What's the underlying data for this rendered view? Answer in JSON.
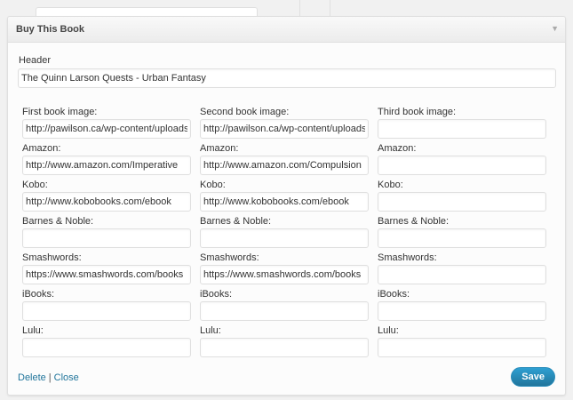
{
  "widget": {
    "title": "Buy This Book",
    "toggle_icon": "triangle-down-icon"
  },
  "header": {
    "label": "Header",
    "value": "The Quinn Larson Quests - Urban Fantasy"
  },
  "columns": [
    {
      "fields": [
        {
          "label": "First book image:",
          "value": "http://pawilson.ca/wp-content/uploads"
        },
        {
          "label": "Amazon:",
          "value": "http://www.amazon.com/Imperative"
        },
        {
          "label": "Kobo:",
          "value": "http://www.kobobooks.com/ebook"
        },
        {
          "label": "Barnes & Noble:",
          "value": ""
        },
        {
          "label": "Smashwords:",
          "value": "https://www.smashwords.com/books"
        },
        {
          "label": "iBooks:",
          "value": ""
        },
        {
          "label": "Lulu:",
          "value": ""
        }
      ]
    },
    {
      "fields": [
        {
          "label": "Second book image:",
          "value": "http://pawilson.ca/wp-content/uploads"
        },
        {
          "label": "Amazon:",
          "value": "http://www.amazon.com/Compulsion"
        },
        {
          "label": "Kobo:",
          "value": "http://www.kobobooks.com/ebook"
        },
        {
          "label": "Barnes & Noble:",
          "value": ""
        },
        {
          "label": "Smashwords:",
          "value": "https://www.smashwords.com/books"
        },
        {
          "label": "iBooks:",
          "value": ""
        },
        {
          "label": "Lulu:",
          "value": ""
        }
      ]
    },
    {
      "fields": [
        {
          "label": "Third book image:",
          "value": ""
        },
        {
          "label": "Amazon:",
          "value": ""
        },
        {
          "label": "Kobo:",
          "value": ""
        },
        {
          "label": "Barnes & Noble:",
          "value": ""
        },
        {
          "label": "Smashwords:",
          "value": ""
        },
        {
          "label": "iBooks:",
          "value": ""
        },
        {
          "label": "Lulu:",
          "value": ""
        }
      ]
    }
  ],
  "footer": {
    "delete_label": "Delete",
    "separator": "|",
    "close_label": "Close",
    "save_label": "Save"
  },
  "colors": {
    "link": "#21759b",
    "primary_button": "#21759b"
  }
}
